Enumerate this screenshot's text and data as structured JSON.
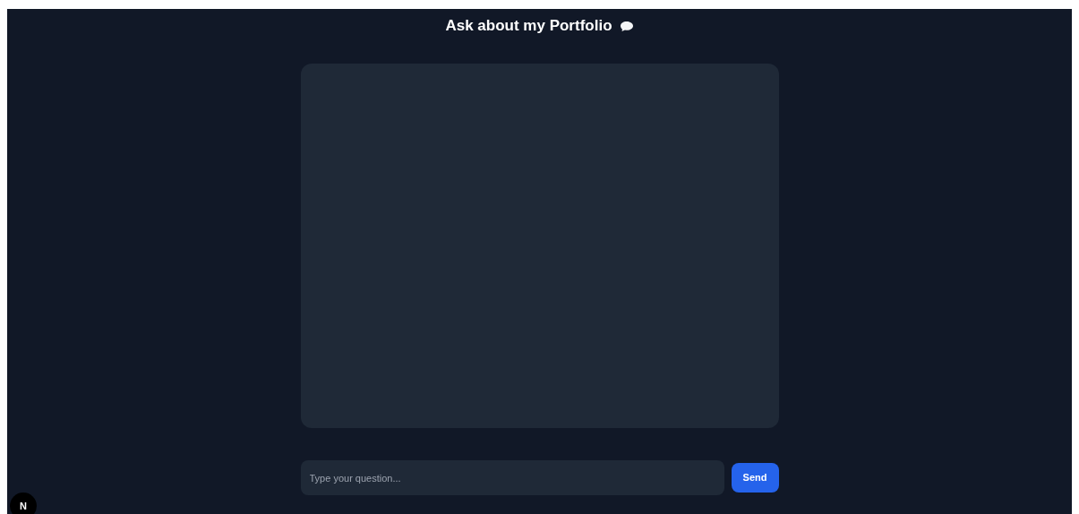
{
  "title": "Ask about my Portfolio",
  "input": {
    "placeholder": "Type your question..."
  },
  "send_button": "Send",
  "dev_badge": "N"
}
